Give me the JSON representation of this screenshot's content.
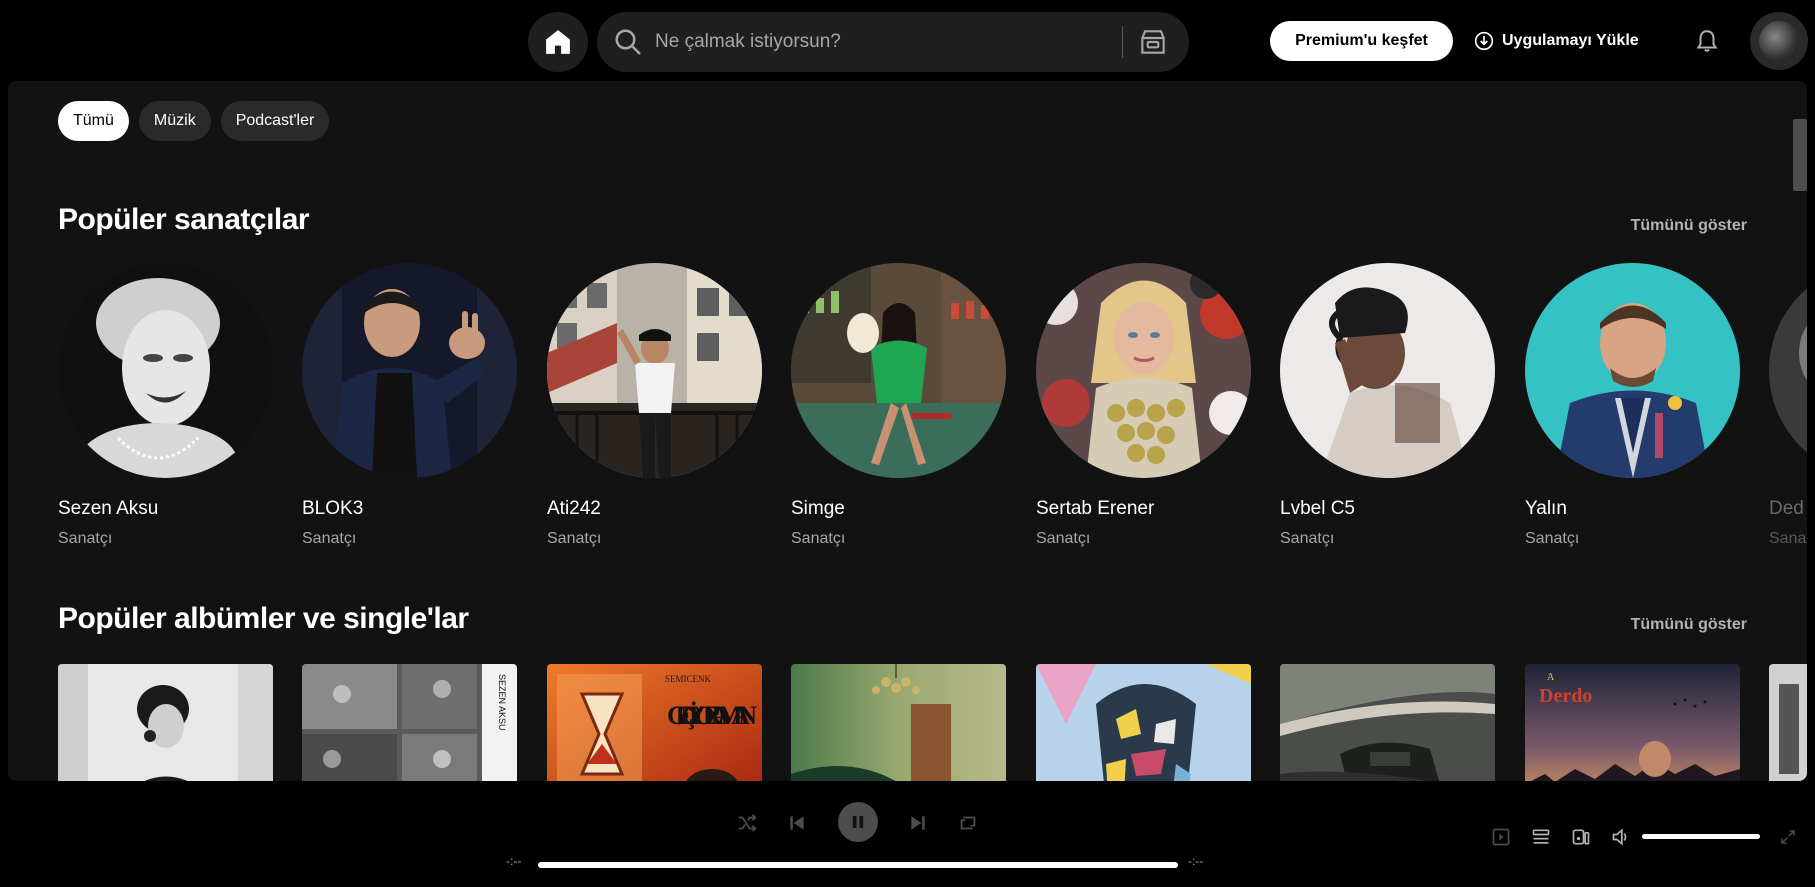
{
  "topbar": {
    "search_placeholder": "Ne çalmak istiyorsun?",
    "premium_label": "Premium'u keşfet",
    "install_label": "Uygulamayı Yükle"
  },
  "filters": [
    {
      "label": "Tümü",
      "active": true
    },
    {
      "label": "Müzik",
      "active": false
    },
    {
      "label": "Podcast'ler",
      "active": false
    }
  ],
  "popular_artists": {
    "title": "Popüler sanatçılar",
    "show_all": "Tümünü göster",
    "items": [
      {
        "name": "Sezen Aksu",
        "role": "Sanatçı"
      },
      {
        "name": "BLOK3",
        "role": "Sanatçı"
      },
      {
        "name": "Ati242",
        "role": "Sanatçı"
      },
      {
        "name": "Simge",
        "role": "Sanatçı"
      },
      {
        "name": "Sertab Erener",
        "role": "Sanatçı"
      },
      {
        "name": "Lvbel C5",
        "role": "Sanatçı"
      },
      {
        "name": "Yalın",
        "role": "Sanatçı"
      },
      {
        "name": "Ded",
        "role": "Sana"
      }
    ]
  },
  "popular_albums": {
    "title": "Popüler albümler ve single'lar",
    "show_all": "Tümünü göster",
    "cover_texts": {
      "album3_top": "SEMICENK",
      "album3_main": "GEÇİYOR ZAMAN",
      "album2_side": "SEZEN AKSU",
      "album7_top": "A",
      "album7_main": "Derdo"
    }
  },
  "player": {
    "time_elapsed": "-:--",
    "time_total": "-:--",
    "progress": 1.0,
    "volume": 1.0
  },
  "colors": {
    "background": "#000000",
    "panel": "#121212",
    "chip": "#2a2a2a",
    "muted_text": "#a7a7a7"
  }
}
